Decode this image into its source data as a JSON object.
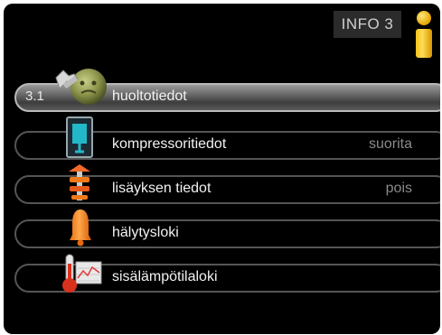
{
  "header": {
    "info_label": "INFO 3",
    "info_icon": "info-icon"
  },
  "menu": {
    "items": [
      {
        "number": "3.1",
        "label": "huoltotiedot",
        "value": "",
        "icon": "service-tools-icon",
        "selected": true
      },
      {
        "number": "",
        "label": "kompressoritiedot",
        "value": "suorita",
        "icon": "compressor-icon",
        "selected": false
      },
      {
        "number": "",
        "label": "lisäyksen tiedot",
        "value": "pois",
        "icon": "additional-heat-icon",
        "selected": false
      },
      {
        "number": "",
        "label": "hälytysloki",
        "value": "",
        "icon": "alarm-bell-icon",
        "selected": false
      },
      {
        "number": "",
        "label": "sisälämpötilaloki",
        "value": "",
        "icon": "thermometer-chart-icon",
        "selected": false
      }
    ]
  },
  "colors": {
    "background": "#000000",
    "selected_row": "#6d6d6d",
    "accent_yellow": "#f4c21a",
    "accent_orange": "#f28a1c"
  }
}
